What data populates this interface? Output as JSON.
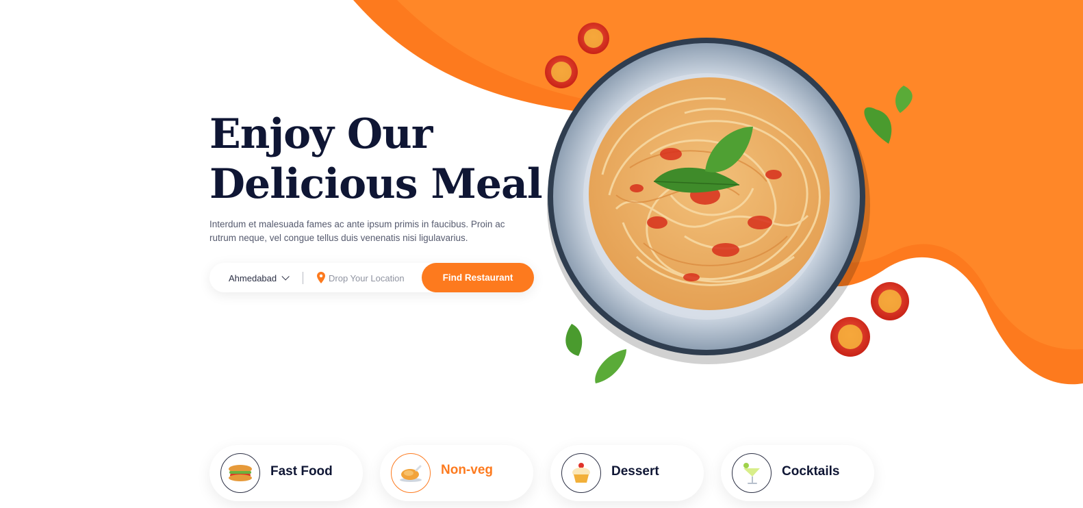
{
  "hero": {
    "title_line1": "Enjoy Our",
    "title_line2": "Delicious Meal",
    "description": "Interdum et malesuada fames ac ante ipsum primis in faucibus. Proin ac rutrum neque, vel congue tellus duis venenatis nisi ligulavarius."
  },
  "search": {
    "city": "Ahmedabad",
    "location_placeholder": "Drop Your Location",
    "button_label": "Find Restaurant"
  },
  "categories": [
    {
      "label": "Fast Food",
      "icon": "sandwich-icon",
      "active": false
    },
    {
      "label": "Non-veg",
      "icon": "roast-chicken-icon",
      "active": true
    },
    {
      "label": "Dessert",
      "icon": "cupcake-icon",
      "active": false
    },
    {
      "label": "Cocktails",
      "icon": "cocktail-icon",
      "active": false
    }
  ],
  "colors": {
    "accent": "#fd7a1e",
    "heading": "#0f1634",
    "text": "#555a6e"
  }
}
